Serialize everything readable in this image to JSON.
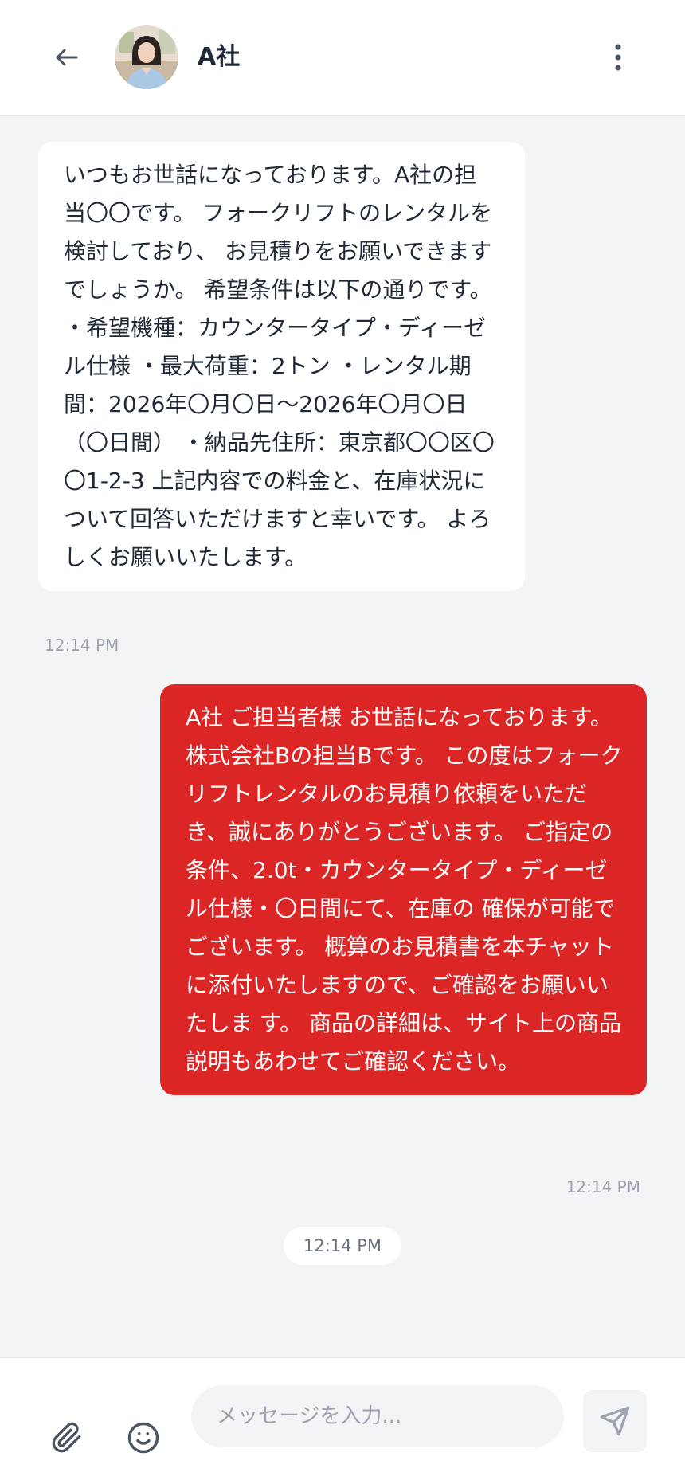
{
  "header": {
    "contact_name": "A社",
    "icons": {
      "back": "arrow-left-icon",
      "avatar": "contact-avatar",
      "more": "more-vertical-icon"
    }
  },
  "messages": [
    {
      "direction": "incoming",
      "text": "いつもお世話になっております。A社の担当〇〇です。 フォークリフトのレンタルを検討しており、 お見積りをお願いできますでしょうか。 希望条件は以下の通りです。 ・希望機種：カウンタータイプ・ディーゼル仕様 ・最大荷重：2トン ・レンタル期間：2026年〇月〇日〜2026年〇月〇日（〇日間） ・納品先住所：東京都〇〇区〇〇1-2-3 上記内容での料金と、在庫状況について回答いただけますと幸いです。 よろしくお願いいたします。",
      "time": "12:14 PM"
    },
    {
      "direction": "outgoing",
      "text": "A社 ご担当者様 お世話になっております。株式会社Bの担当Bです。 この度はフォークリフトレンタルのお見積り依頼をいただき、誠にありがとうございます。 ご指定の条件、2.0t・カウンタータイプ・ディーゼル仕様・〇日間にて、在庫の 確保が可能でございます。 概算のお見積書を本チャットに添付いたしますので、ご確認をお願いいたしま す。 商品の詳細は、サイト上の商品説明もあわせてご確認ください。",
      "time": "12:14 PM"
    }
  ],
  "date_chip": "12:14 PM",
  "composer": {
    "placeholder": "メッセージを入力...",
    "value": "",
    "icons": {
      "attach": "paperclip-icon",
      "emoji": "smiley-icon",
      "send": "send-icon"
    }
  },
  "colors": {
    "accent": "#dc2626",
    "background": "#f3f4f6",
    "incoming_bubble": "#ffffff",
    "muted_text": "#9ca3af"
  }
}
